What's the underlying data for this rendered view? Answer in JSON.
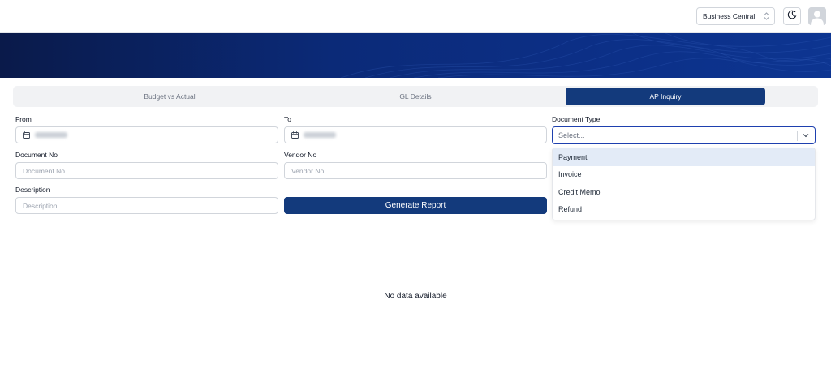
{
  "header": {
    "environment": "Business Central",
    "icons": {
      "env_chevron": "chevron-up-down-icon",
      "theme": "moon-icon",
      "avatar": "user-avatar-icon"
    }
  },
  "tabs": [
    {
      "label": "Budget vs Actual",
      "active": false
    },
    {
      "label": "GL Details",
      "active": false
    },
    {
      "label": "AP Inquiry",
      "active": true
    }
  ],
  "form": {
    "from": {
      "label": "From"
    },
    "to": {
      "label": "To"
    },
    "document_type": {
      "label": "Document Type",
      "placeholder": "Select..."
    },
    "document_no": {
      "label": "Document No",
      "placeholder": "Document No"
    },
    "vendor_no": {
      "label": "Vendor No",
      "placeholder": "Vendor No"
    },
    "description": {
      "label": "Description",
      "placeholder": "Description"
    },
    "generate_label": "Generate Report"
  },
  "document_type_options": [
    "Payment",
    "Invoice",
    "Credit Memo",
    "Refund"
  ],
  "highlighted_option": "Payment",
  "results": {
    "empty_message": "No data available"
  },
  "colors": {
    "primary": "#133a7c",
    "banner": "#0c2f86",
    "highlight": "#e3ebf7"
  }
}
